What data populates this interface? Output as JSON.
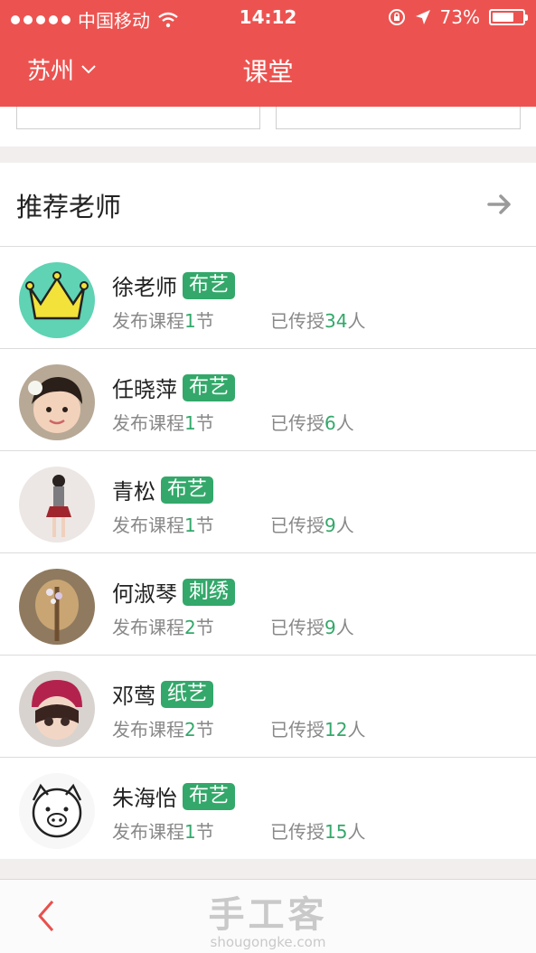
{
  "status_bar": {
    "carrier": "中国移动",
    "time": "14:12",
    "battery_text": "73%",
    "battery_level": 0.73
  },
  "nav": {
    "city": "苏州",
    "title": "课堂"
  },
  "section": {
    "title": "推荐老师"
  },
  "teachers": [
    {
      "name": "徐老师",
      "tag": "布艺",
      "courses_prefix": "发布课程",
      "courses": "1",
      "courses_suffix": "节",
      "taught_prefix": "已传授",
      "taught": "34",
      "taught_suffix": "人"
    },
    {
      "name": "任晓萍",
      "tag": "布艺",
      "courses_prefix": "发布课程",
      "courses": "1",
      "courses_suffix": "节",
      "taught_prefix": "已传授",
      "taught": "6",
      "taught_suffix": "人"
    },
    {
      "name": "青松",
      "tag": "布艺",
      "courses_prefix": "发布课程",
      "courses": "1",
      "courses_suffix": "节",
      "taught_prefix": "已传授",
      "taught": "9",
      "taught_suffix": "人"
    },
    {
      "name": "何淑琴",
      "tag": "刺绣",
      "courses_prefix": "发布课程",
      "courses": "2",
      "courses_suffix": "节",
      "taught_prefix": "已传授",
      "taught": "9",
      "taught_suffix": "人"
    },
    {
      "name": "邓莺",
      "tag": "纸艺",
      "courses_prefix": "发布课程",
      "courses": "2",
      "courses_suffix": "节",
      "taught_prefix": "已传授",
      "taught": "12",
      "taught_suffix": "人"
    },
    {
      "name": "朱海怡",
      "tag": "布艺",
      "courses_prefix": "发布课程",
      "courses": "1",
      "courses_suffix": "节",
      "taught_prefix": "已传授",
      "taught": "15",
      "taught_suffix": "人"
    }
  ],
  "watermark": {
    "cn": "手工客",
    "en": "shougongke.com"
  },
  "colors": {
    "brand_red": "#ec5350",
    "tag_green": "#33a86a"
  }
}
